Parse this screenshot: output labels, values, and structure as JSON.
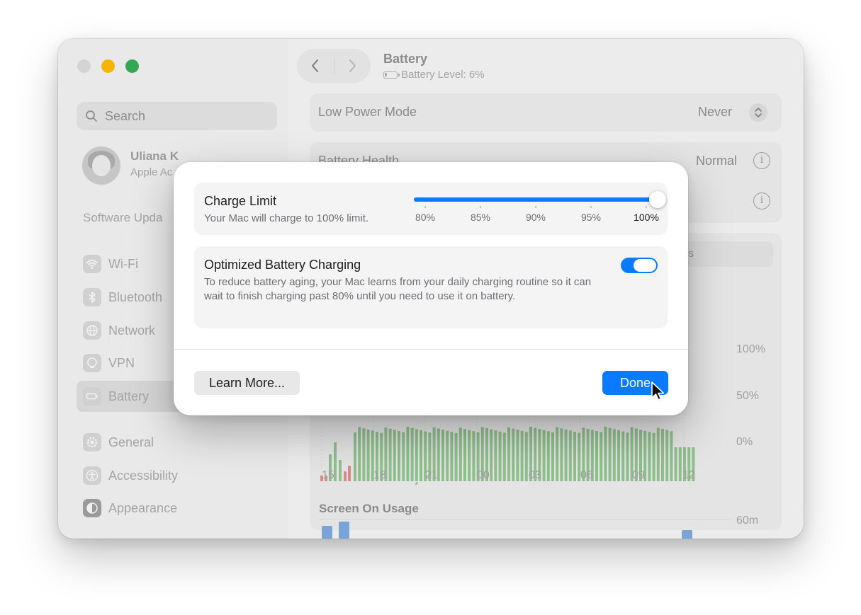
{
  "window": {
    "title": "Battery",
    "battery_level": "Battery Level: 6%"
  },
  "sidebar": {
    "search_placeholder": "Search",
    "user": {
      "name": "Uliana K",
      "subtitle": "Apple Ac"
    },
    "software_update": "Software Upda",
    "items": [
      {
        "label": "Wi-Fi",
        "icon": "wifi-icon"
      },
      {
        "label": "Bluetooth",
        "icon": "bluetooth-icon"
      },
      {
        "label": "Network",
        "icon": "network-icon"
      },
      {
        "label": "VPN",
        "icon": "vpn-icon"
      },
      {
        "label": "Battery",
        "icon": "battery-icon",
        "active": true
      },
      {
        "label": "General",
        "icon": "gear-icon"
      },
      {
        "label": "Accessibility",
        "icon": "accessibility-icon"
      },
      {
        "label": "Appearance",
        "icon": "appearance-icon"
      }
    ]
  },
  "main": {
    "low_power": {
      "label": "Low Power Mode",
      "value": "Never"
    },
    "battery_health": {
      "label": "Battery Health",
      "value": "Normal"
    },
    "segment_partial": "ys",
    "chart": {
      "y_labels": [
        "100%",
        "50%",
        "0%"
      ],
      "x_labels": [
        "15",
        "18",
        "21",
        "00",
        "03",
        "06",
        "09",
        "12"
      ]
    },
    "screen_usage": {
      "title": "Screen On Usage",
      "y_label": "60m"
    }
  },
  "dialog": {
    "charge_limit": {
      "title": "Charge Limit",
      "description": "Your Mac will charge to 100% limit.",
      "value_percent": 100,
      "ticks": [
        "80%",
        "85%",
        "90%",
        "95%",
        "100%"
      ]
    },
    "optimized": {
      "title": "Optimized Battery Charging",
      "description": "To reduce battery aging, your Mac learns from your daily charging routine so it can wait to finish charging past 80% until you need to use it on battery.",
      "enabled": true
    },
    "learn_more": "Learn More...",
    "done": "Done"
  },
  "colors": {
    "accent": "#0a7aff",
    "chart_green": "#8fbf8c",
    "chart_red": "#d98a8a",
    "usage_blue": "#7aa3d8"
  }
}
